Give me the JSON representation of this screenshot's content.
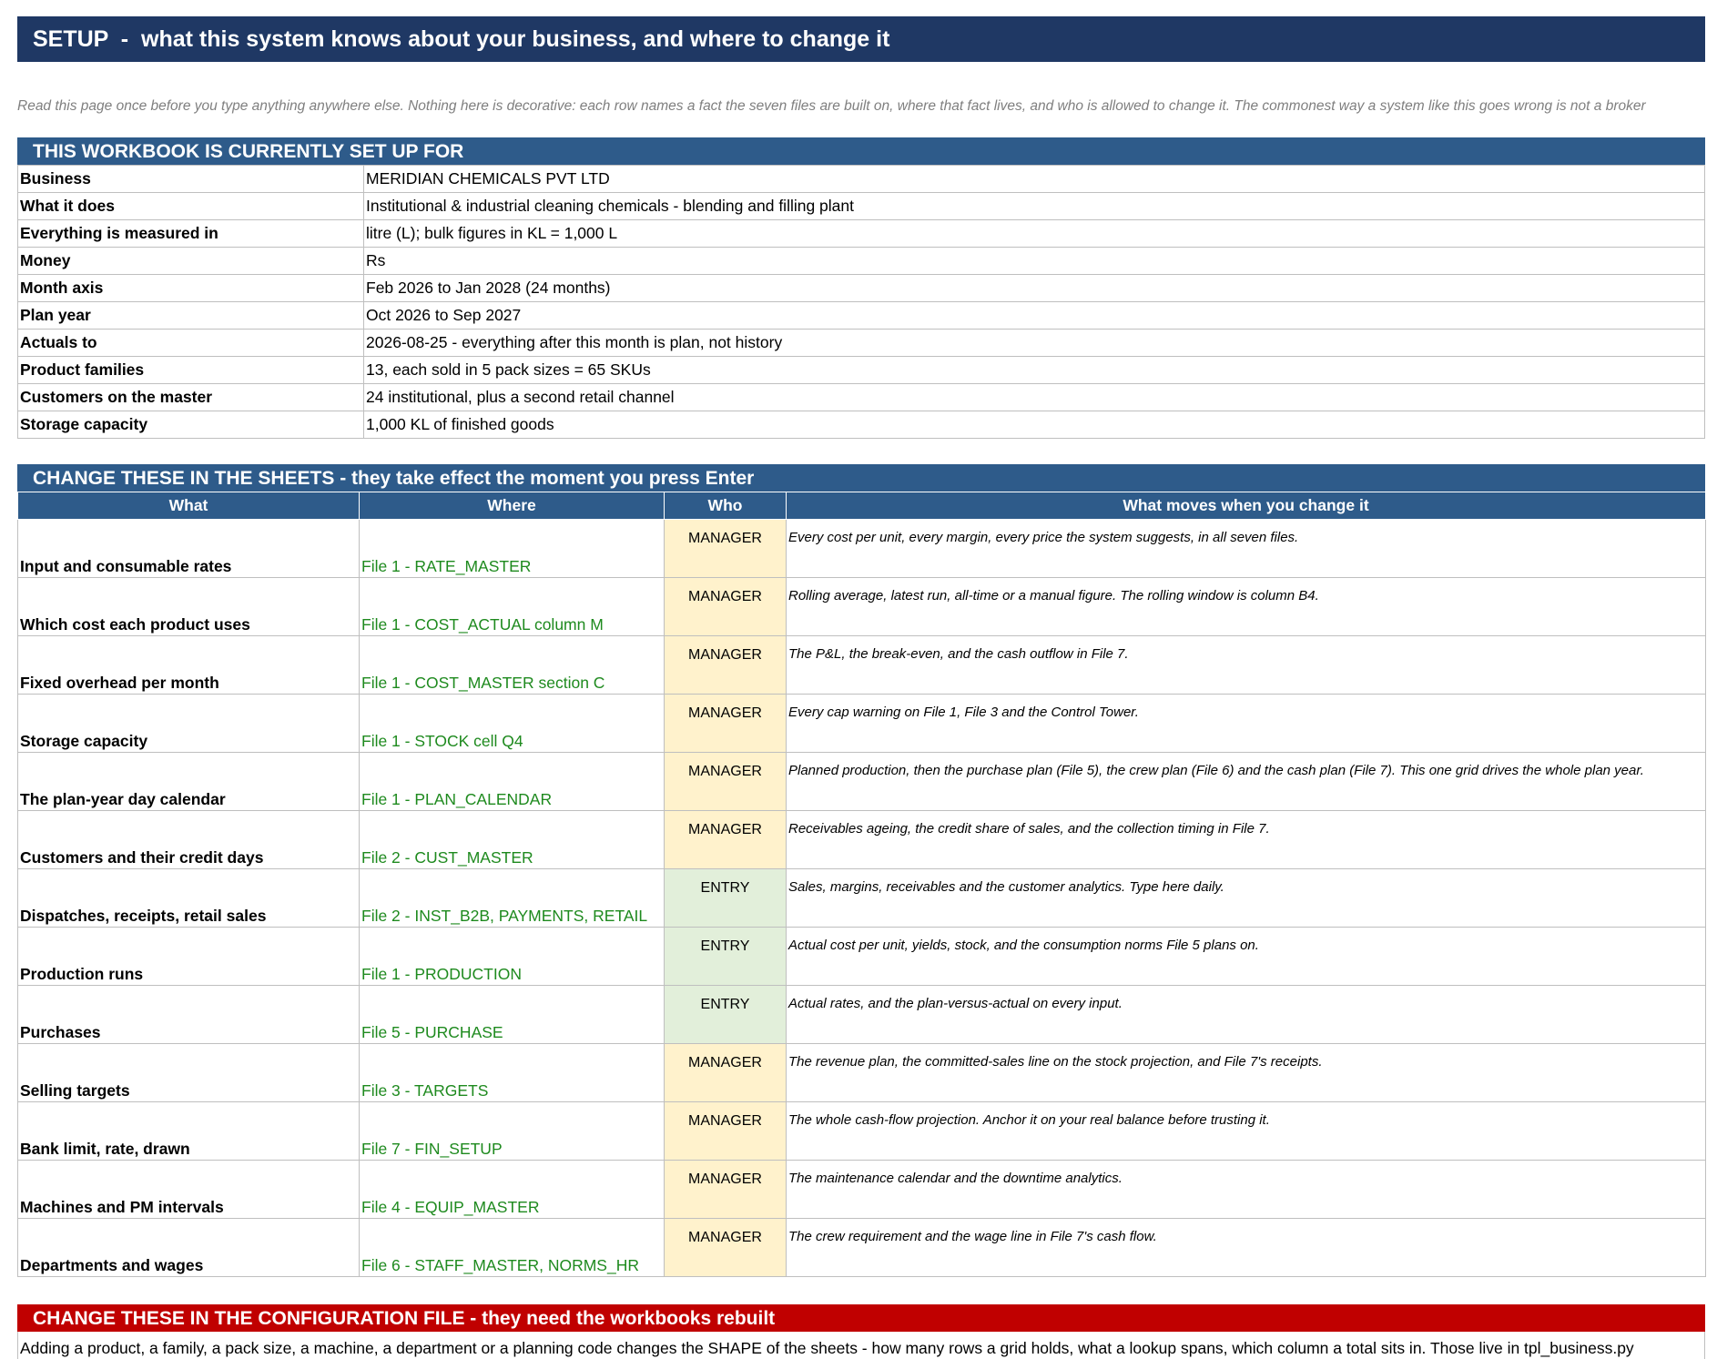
{
  "title": "SETUP  -  what this system knows about your business, and where to change it",
  "intro": "Read this page once before you type anything anywhere else. Nothing here is decorative: each row names a fact the seven files are built on, where that fact lives, and who is allowed to change it. The commonest way a system like this goes wrong is not a broker",
  "setup": {
    "heading": "THIS WORKBOOK IS CURRENTLY SET UP FOR",
    "rows": [
      {
        "key": "Business",
        "value": "MERIDIAN CHEMICALS PVT LTD"
      },
      {
        "key": "What it does",
        "value": "Institutional & industrial cleaning chemicals - blending and filling plant"
      },
      {
        "key": "Everything is measured in",
        "value": "litre (L); bulk figures in KL = 1,000 L"
      },
      {
        "key": "Money",
        "value": "Rs"
      },
      {
        "key": "Month axis",
        "value": "Feb 2026 to Jan 2028  (24 months)"
      },
      {
        "key": "Plan year",
        "value": "Oct 2026 to Sep 2027"
      },
      {
        "key": "Actuals to",
        "value": "2026-08-25  -  everything after this month is plan, not history"
      },
      {
        "key": "Product families",
        "value": "13, each sold in 5 pack sizes = 65 SKUs"
      },
      {
        "key": "Customers on the master",
        "value": "24 institutional, plus a second retail channel"
      },
      {
        "key": "Storage capacity",
        "value": "1,000 KL of finished goods"
      }
    ]
  },
  "changes": {
    "heading": "CHANGE THESE IN THE SHEETS - they take effect the moment you press Enter",
    "columns": [
      "What",
      "Where",
      "Who",
      "What moves when you change it"
    ],
    "rows": [
      {
        "what": "Input and consumable rates",
        "where": "File 1 - RATE_MASTER",
        "who": "MANAGER",
        "moves": "Every cost per unit, every margin, every price the system suggests, in all seven files."
      },
      {
        "what": "Which cost each product uses",
        "where": "File 1 - COST_ACTUAL column M",
        "who": "MANAGER",
        "moves": "Rolling average, latest run, all-time or a manual figure. The rolling window is column B4."
      },
      {
        "what": "Fixed overhead per month",
        "where": "File 1 - COST_MASTER section C",
        "who": "MANAGER",
        "moves": "The P&L, the break-even, and the cash outflow in File 7."
      },
      {
        "what": "Storage capacity",
        "where": "File 1 - STOCK cell Q4",
        "who": "MANAGER",
        "moves": "Every cap warning on File 1, File 3 and the Control Tower."
      },
      {
        "what": "The plan-year day calendar",
        "where": "File 1 - PLAN_CALENDAR",
        "who": "MANAGER",
        "moves": "Planned production, then the purchase plan (File 5), the crew plan (File 6) and the cash plan (File 7). This one grid drives the whole plan year."
      },
      {
        "what": "Customers and their credit days",
        "where": "File 2 - CUST_MASTER",
        "who": "MANAGER",
        "moves": "Receivables ageing, the credit share of sales, and the collection timing in File 7."
      },
      {
        "what": "Dispatches, receipts, retail sales",
        "where": "File 2 - INST_B2B, PAYMENTS, RETAIL",
        "who": "ENTRY",
        "moves": "Sales, margins, receivables and the customer analytics. Type here daily."
      },
      {
        "what": "Production runs",
        "where": "File 1 - PRODUCTION",
        "who": "ENTRY",
        "moves": "Actual cost per unit, yields, stock, and the consumption norms File 5 plans on."
      },
      {
        "what": "Purchases",
        "where": "File 5 - PURCHASE",
        "who": "ENTRY",
        "moves": "Actual rates, and the plan-versus-actual on every input."
      },
      {
        "what": "Selling targets",
        "where": "File 3 - TARGETS",
        "who": "MANAGER",
        "moves": "The revenue plan, the committed-sales line on the stock projection, and File 7's receipts."
      },
      {
        "what": "Bank limit, rate, drawn",
        "where": "File 7 - FIN_SETUP",
        "who": "MANAGER",
        "moves": "The whole cash-flow projection. Anchor it on your real balance before trusting it."
      },
      {
        "what": "Machines and PM intervals",
        "where": "File 4 - EQUIP_MASTER",
        "who": "MANAGER",
        "moves": "The maintenance calendar and the downtime analytics."
      },
      {
        "what": "Departments and wages",
        "where": "File 6 - STAFF_MASTER, NORMS_HR",
        "who": "MANAGER",
        "moves": "The crew requirement and the wage line in File 7's cash flow."
      }
    ]
  },
  "config": {
    "heading": "CHANGE THESE IN THE CONFIGURATION FILE - they need the workbooks rebuilt",
    "text": "Adding a product, a family, a pack size, a machine, a department or a planning code changes the SHAPE of the sheets - how many rows a grid holds, what a lookup spans, which column a total sits in. Those live in tpl_business.py"
  },
  "colors": {
    "title_bg": "#1f3864",
    "section_bg": "#2e5b8a",
    "config_bg": "#c00000",
    "manager_bg": "#fff2cc",
    "entry_bg": "#e2efda",
    "where_text": "#1e8a1e"
  }
}
